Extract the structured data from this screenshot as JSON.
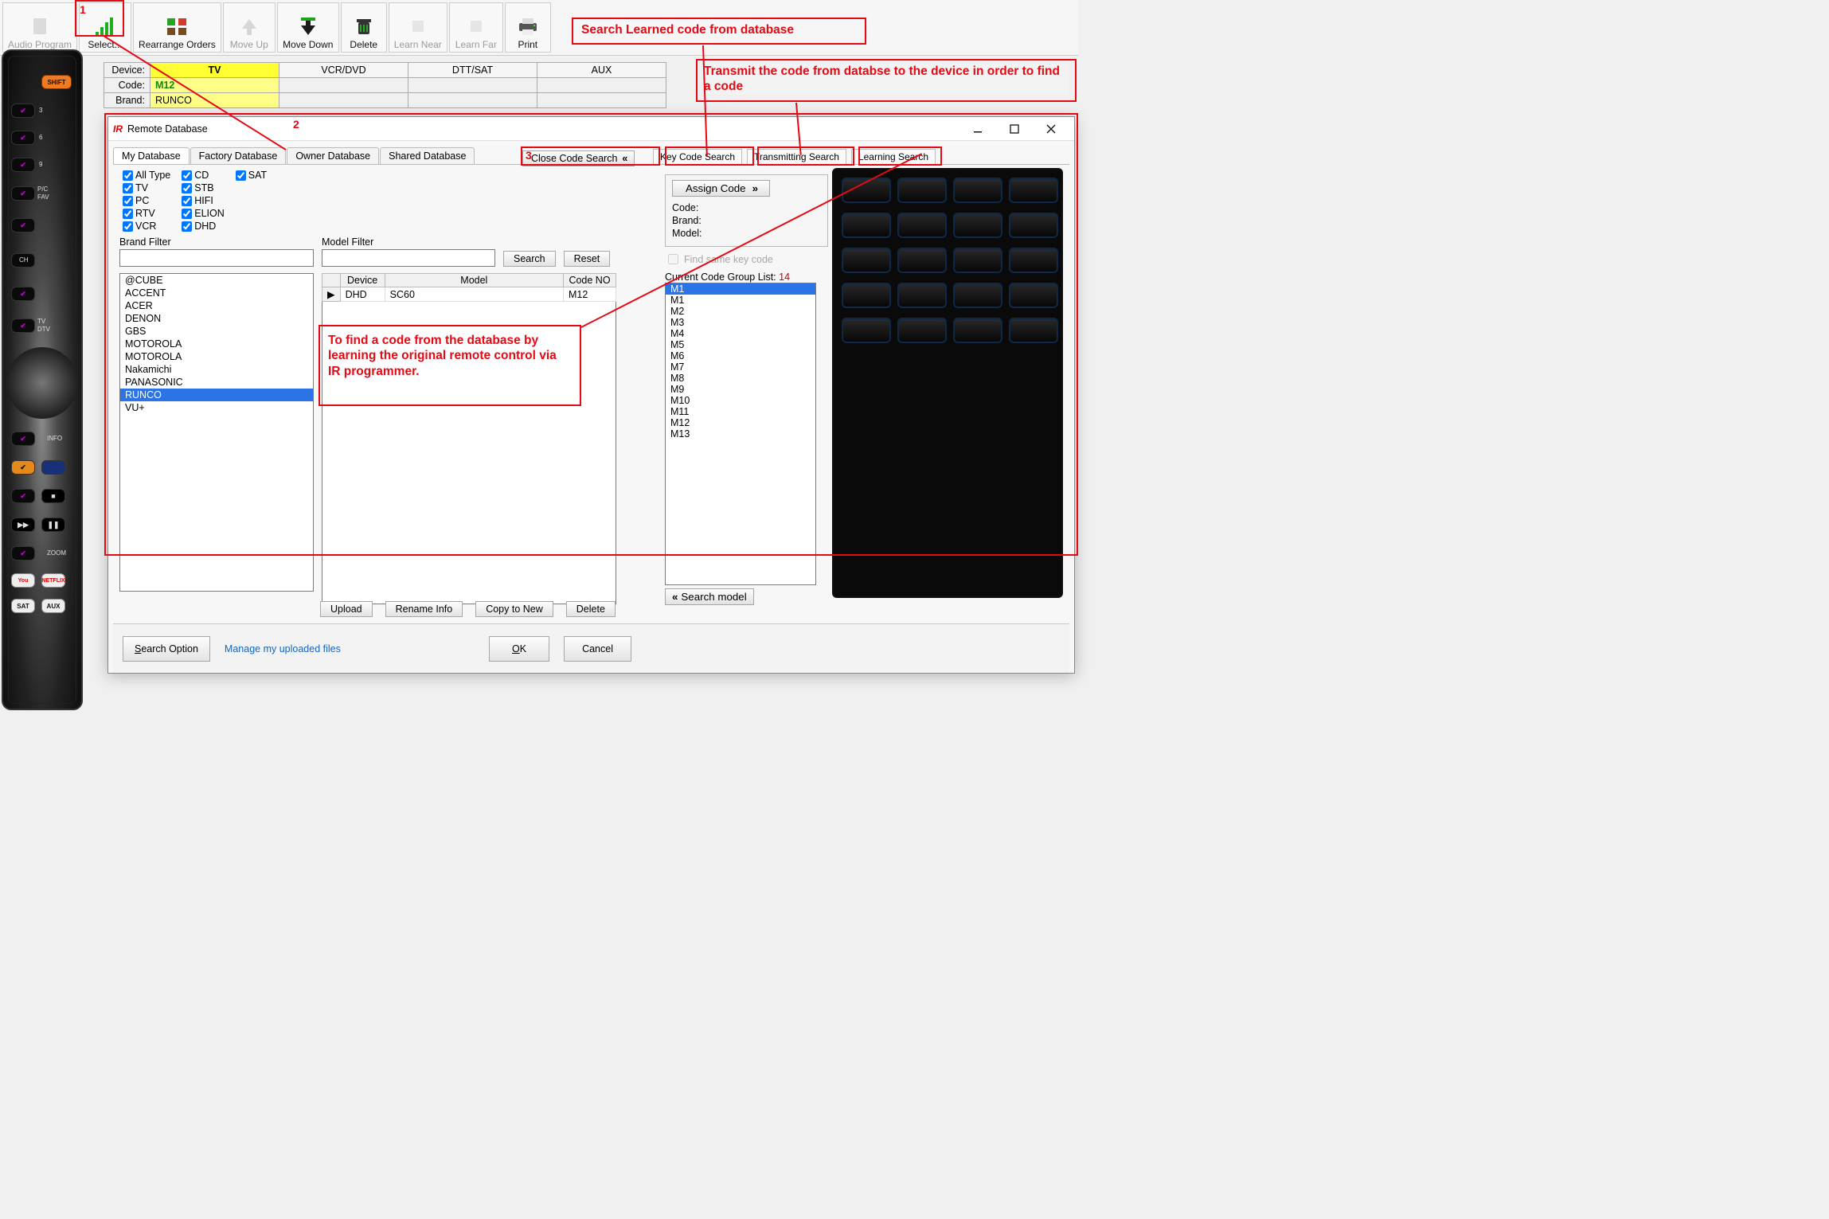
{
  "toolbar": [
    {
      "key": "audio-program",
      "label": "Audio Program",
      "disabled": true
    },
    {
      "key": "select",
      "label": "Select...",
      "disabled": false
    },
    {
      "key": "rearrange",
      "label": "Rearrange Orders",
      "disabled": false
    },
    {
      "key": "move-up",
      "label": "Move Up",
      "disabled": true
    },
    {
      "key": "move-down",
      "label": "Move Down",
      "disabled": false
    },
    {
      "key": "delete",
      "label": "Delete",
      "disabled": false
    },
    {
      "key": "learn-near",
      "label": "Learn Near",
      "disabled": true
    },
    {
      "key": "learn-far",
      "label": "Learn Far",
      "disabled": true
    },
    {
      "key": "print",
      "label": "Print",
      "disabled": false
    }
  ],
  "deviceTable": {
    "rowLabels": [
      "Device:",
      "Code:",
      "Brand:"
    ],
    "headers": [
      "TV",
      "VCR/DVD",
      "DTT/SAT",
      "AUX"
    ],
    "code": "M12",
    "brand": "RUNCO"
  },
  "modal": {
    "title": "Remote Database",
    "dbTabs": [
      "My Database",
      "Factory Database",
      "Owner Database",
      "Shared Database"
    ],
    "closeCodeSearch": "Close Code Search",
    "searchTabs": [
      "Key Code Search",
      "Transmitting Search",
      "Learning Search"
    ],
    "filterTypes": [
      [
        "All Type",
        "TV",
        "PC",
        "RTV",
        "VCR"
      ],
      [
        "CD",
        "STB",
        "HIFI",
        "ELION",
        "DHD"
      ],
      [
        "SAT"
      ]
    ],
    "brandFilterLabel": "Brand Filter",
    "modelFilterLabel": "Model Filter",
    "searchBtn": "Search",
    "resetBtn": "Reset",
    "brands": [
      "@CUBE",
      "ACCENT",
      "ACER",
      "DENON",
      "GBS",
      "MOTOROLA",
      "MOTOROLA",
      "Nakamichi",
      "PANASONIC",
      "RUNCO",
      "VU+"
    ],
    "brandSelected": "RUNCO",
    "modelGrid": {
      "cols": [
        "Device",
        "Model",
        "Code NO"
      ],
      "rows": [
        [
          "DHD",
          "SC60",
          "M12"
        ]
      ]
    },
    "assign": {
      "btn": "Assign Code",
      "code": "Code:",
      "brand": "Brand:",
      "model": "Model:",
      "findSame": "Find same key code"
    },
    "currentListLabel": "Current Code Group List:",
    "currentListCount": "14",
    "codeList": [
      "M1",
      "M1",
      "M2",
      "M3",
      "M4",
      "M5",
      "M6",
      "M7",
      "M8",
      "M9",
      "M10",
      "M11",
      "M12",
      "M13"
    ],
    "footerBtns": [
      "Upload",
      "Rename Info",
      "Copy to New",
      "Delete"
    ],
    "searchModel": "Search model",
    "bottom": {
      "searchOption": "Search Option",
      "manage": "Manage my uploaded files",
      "ok": "OK",
      "cancel": "Cancel"
    }
  },
  "anno": {
    "n1": "1",
    "n2": "2",
    "n3": "3",
    "learned": "Search Learned code from database",
    "transmit": "Transmit the code from databse to the device in order to find a code",
    "find": "To find a code from the database by learning the original remote control via IR programmer."
  }
}
